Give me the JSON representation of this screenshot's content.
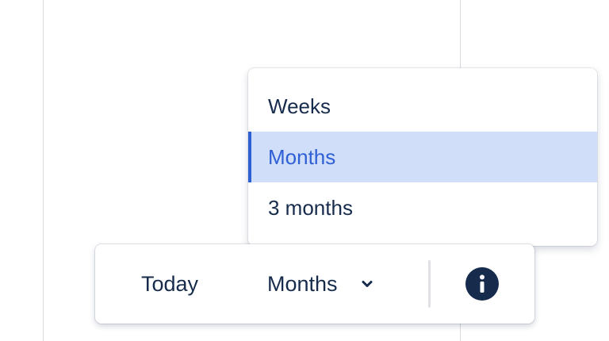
{
  "view_menu": {
    "options": [
      {
        "label": "Weeks",
        "selected": false
      },
      {
        "label": "Months",
        "selected": true
      },
      {
        "label": "3 months",
        "selected": false
      }
    ]
  },
  "toolbar": {
    "today_label": "Today",
    "view_selected_label": "Months"
  },
  "icons": {
    "chevron": "chevron-down-icon",
    "info": "info-icon"
  },
  "colors": {
    "text": "#172b4d",
    "selected_bg": "#d1defa",
    "selected_text": "#2f5fd4",
    "info_bg": "#172b4d"
  }
}
